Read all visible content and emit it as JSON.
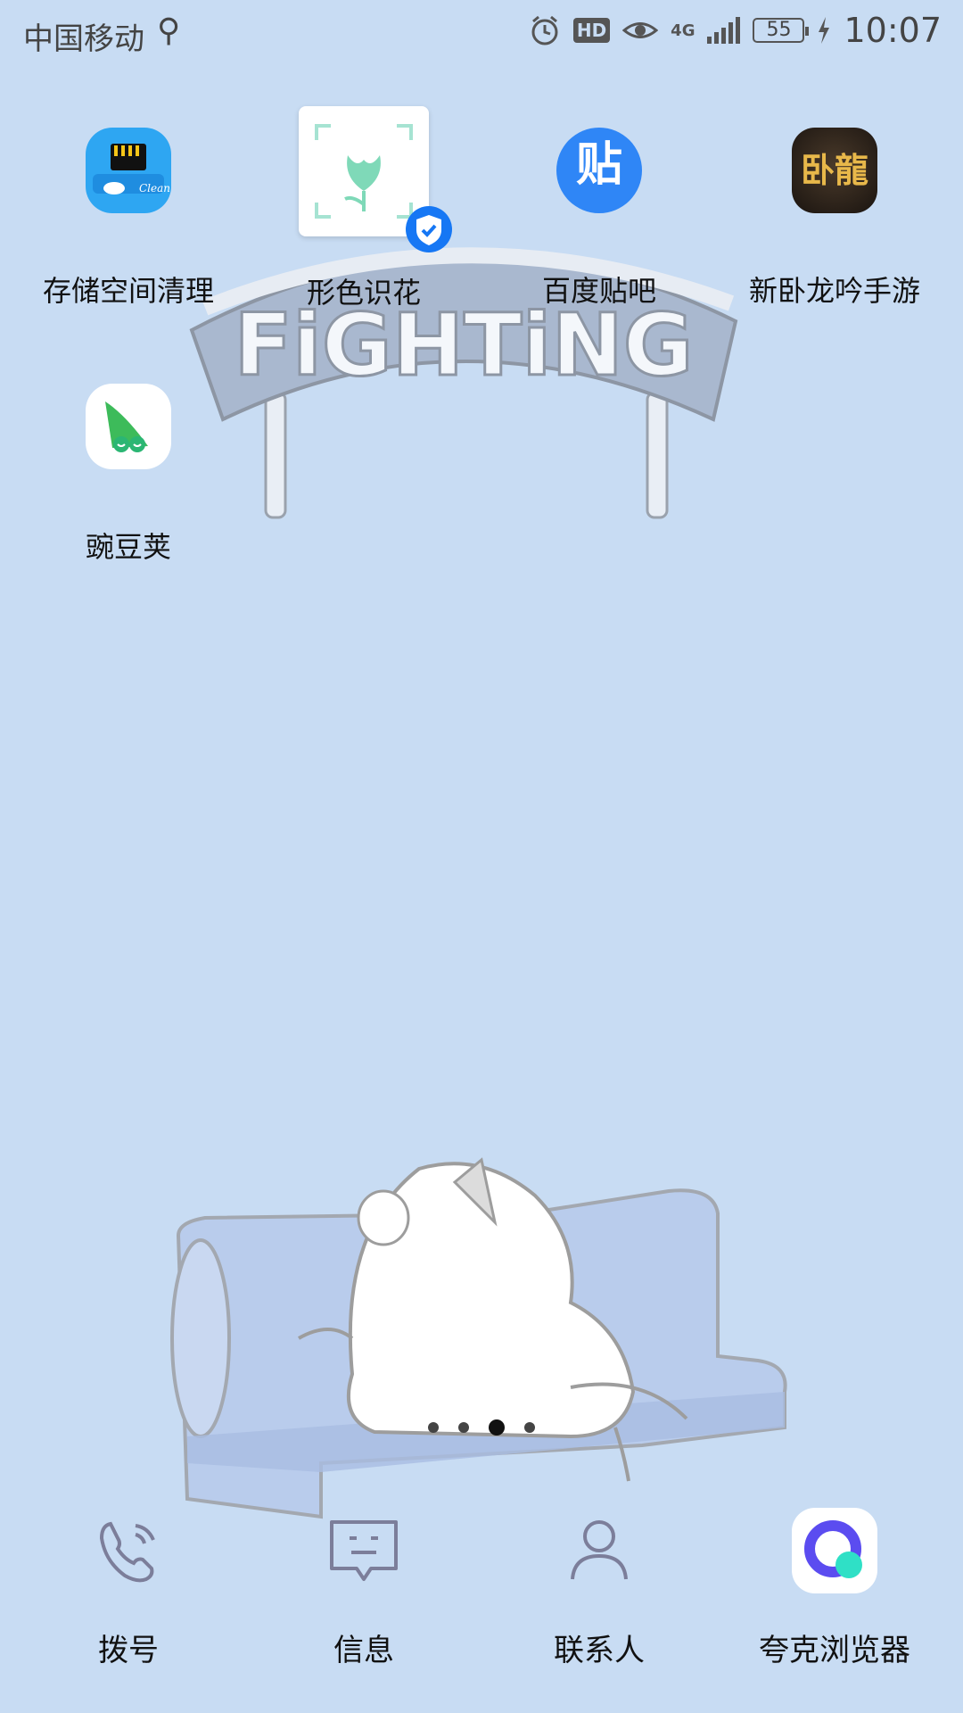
{
  "status_bar": {
    "carrier": "中国移动",
    "network": "4G",
    "battery_level": "55",
    "time": "10:07",
    "icons": [
      "usb-icon",
      "alarm-icon",
      "hd-icon",
      "eye-icon",
      "signal-icon",
      "charging-icon"
    ]
  },
  "wallpaper": {
    "banner_text": "FiGHTiNG"
  },
  "apps": [
    {
      "label": "存储空间清理",
      "icon": "storage-clean-icon"
    },
    {
      "label": "形色识花",
      "icon": "flower-recognition-icon"
    },
    {
      "label": "百度贴吧",
      "icon": "baidu-tieba-icon",
      "icon_text": "贴"
    },
    {
      "label": "新卧龙吟手游",
      "icon": "wolong-game-icon",
      "icon_text": "卧龍"
    },
    {
      "label": "豌豆荚",
      "icon": "wandoujia-icon"
    }
  ],
  "page_indicator": {
    "pages": 4,
    "current": 3
  },
  "dock": [
    {
      "label": "拨号",
      "icon": "phone-icon"
    },
    {
      "label": "信息",
      "icon": "message-icon"
    },
    {
      "label": "联系人",
      "icon": "contacts-icon"
    },
    {
      "label": "夸克浏览器",
      "icon": "quark-browser-icon"
    }
  ],
  "colors": {
    "background": "#c8dcf3",
    "accent_blue": "#2f86f6"
  }
}
